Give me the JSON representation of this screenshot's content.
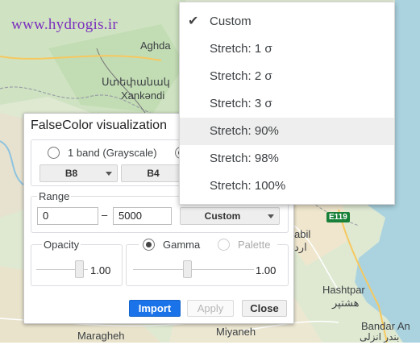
{
  "map": {
    "labels": [
      "Aghda",
      "Ստեփանակ",
      "Xankəndi",
      "abil",
      "ارد",
      "Hashtpar",
      "هشتپر",
      "Bandar An",
      "بندر انزلی",
      "Maragheh",
      "Miyaneh"
    ],
    "road_shield": "E119",
    "watermark": "www.hydrogis.ir"
  },
  "dialog": {
    "title": "FalseColor visualization",
    "bands_mode": {
      "option1_label": "1 band (Grayscale)",
      "selected_band_1": "B8",
      "selected_band_2": "B4"
    },
    "range": {
      "legend": "Range",
      "min": "0",
      "dash": "–",
      "max": "5000",
      "stretch_value": "Custom"
    },
    "opacity": {
      "legend": "Opacity",
      "value": "1.00",
      "level": 1.0
    },
    "gamma": {
      "gamma_label": "Gamma",
      "palette_label": "Palette",
      "value": "1.00",
      "level": 1.0
    },
    "buttons": {
      "import": "Import",
      "apply": "Apply",
      "close": "Close"
    }
  },
  "dropdown": {
    "options": [
      "Custom",
      "Stretch: 1 σ",
      "Stretch: 2 σ",
      "Stretch: 3 σ",
      "Stretch: 90%",
      "Stretch: 98%",
      "Stretch: 100%"
    ],
    "selected": "Custom",
    "highlighted": "Stretch: 90%",
    "check_glyph": "✔"
  }
}
